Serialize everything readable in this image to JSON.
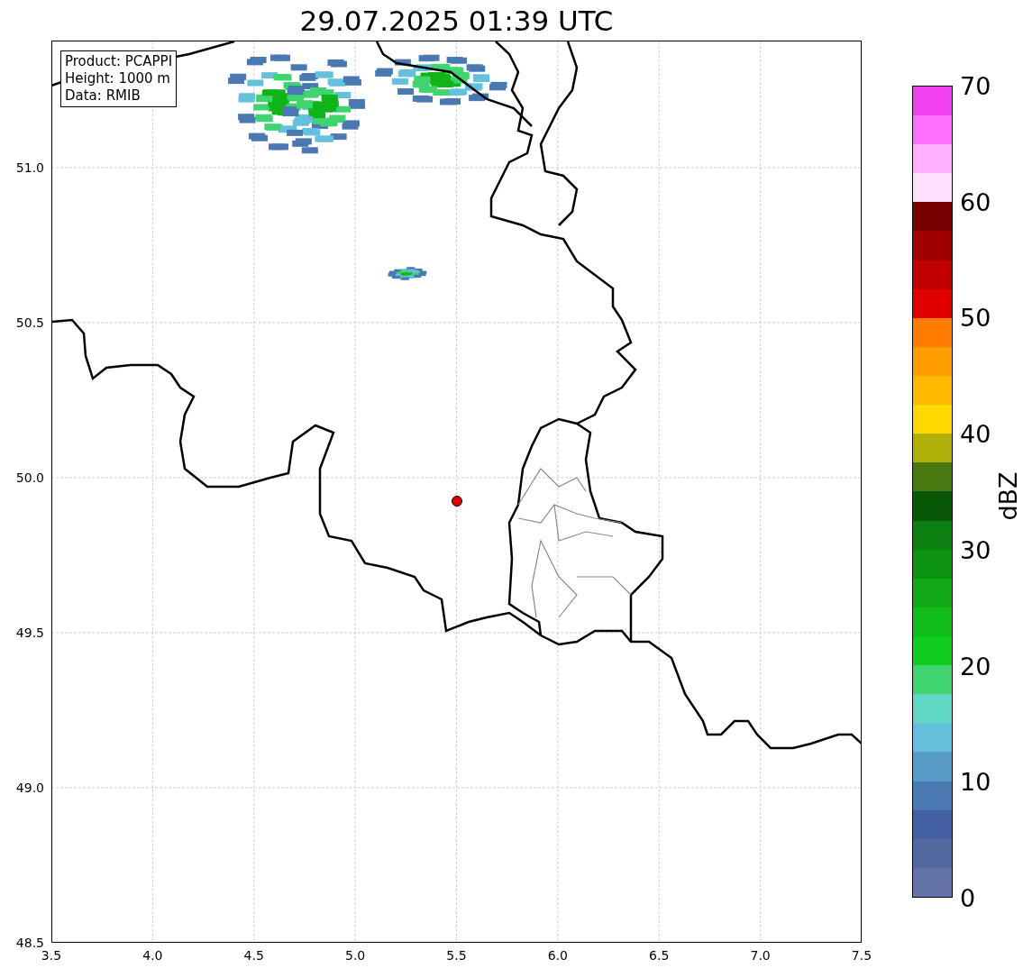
{
  "title": "29.07.2025 01:39 UTC",
  "info_box": [
    "Product: PCAPPI",
    "Height: 1000 m",
    "Data: RMIB"
  ],
  "x_ticks": [
    "3.5",
    "4.0",
    "4.5",
    "5.0",
    "5.5",
    "6.0",
    "6.5",
    "7.0",
    "7.5"
  ],
  "y_ticks": [
    "51.0",
    "50.5",
    "50.0",
    "49.5",
    "49.0",
    "48.5"
  ],
  "colorbar": {
    "label": "dBZ",
    "ticks": [
      "70",
      "60",
      "50",
      "40",
      "30",
      "20",
      "10",
      "0"
    ],
    "bands": [
      {
        "color": "#6474a8"
      },
      {
        "color": "#5468a0"
      },
      {
        "color": "#4460a4"
      },
      {
        "color": "#4a78b0"
      },
      {
        "color": "#5a9cc8"
      },
      {
        "color": "#64c0dc"
      },
      {
        "color": "#60d8c4"
      },
      {
        "color": "#40d470"
      },
      {
        "color": "#10cc1c"
      },
      {
        "color": "#10bc18"
      },
      {
        "color": "#10a814"
      },
      {
        "color": "#0c9410"
      },
      {
        "color": "#0c8010"
      },
      {
        "color": "#085808"
      },
      {
        "color": "#487810"
      },
      {
        "color": "#b0b008"
      },
      {
        "color": "#ffd800"
      },
      {
        "color": "#ffb800"
      },
      {
        "color": "#ff9c00"
      },
      {
        "color": "#ff7c00"
      },
      {
        "color": "#e00000"
      },
      {
        "color": "#c00000"
      },
      {
        "color": "#a00000"
      },
      {
        "color": "#780000"
      },
      {
        "color": "#ffe0ff"
      },
      {
        "color": "#ffb0ff"
      },
      {
        "color": "#ff70ff"
      },
      {
        "color": "#f040f0"
      }
    ]
  }
}
